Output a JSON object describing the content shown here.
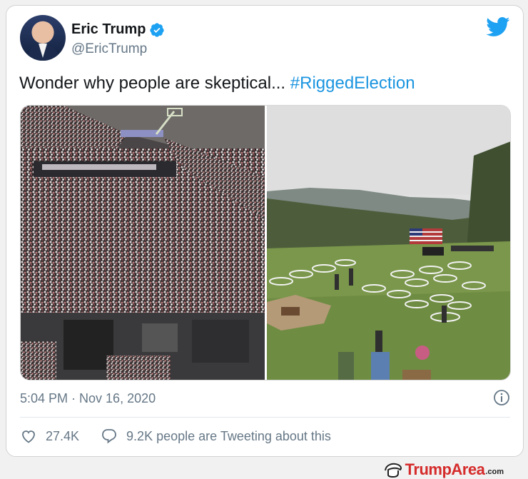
{
  "tweet": {
    "author_name": "Eric Trump",
    "author_handle": "@EricTrump",
    "text": "Wonder why people are skeptical... ",
    "hashtag": "#RiggedElection",
    "timestamp": "5:04 PM · Nov 16, 2020",
    "likes": "27.4K",
    "tweeting_about": "9.2K people are Tweeting about this"
  },
  "media": {
    "left_photo": "rally-crowd-photo",
    "right_photo": "distanced-circles-event-photo"
  },
  "colors": {
    "twitter_blue": "#1da1f2",
    "hashtag": "#1b95e0",
    "secondary_text": "#657786",
    "watermark_red": "#d52b2b"
  },
  "watermark": {
    "brand": "TrumpArea",
    "domain": ".com"
  }
}
